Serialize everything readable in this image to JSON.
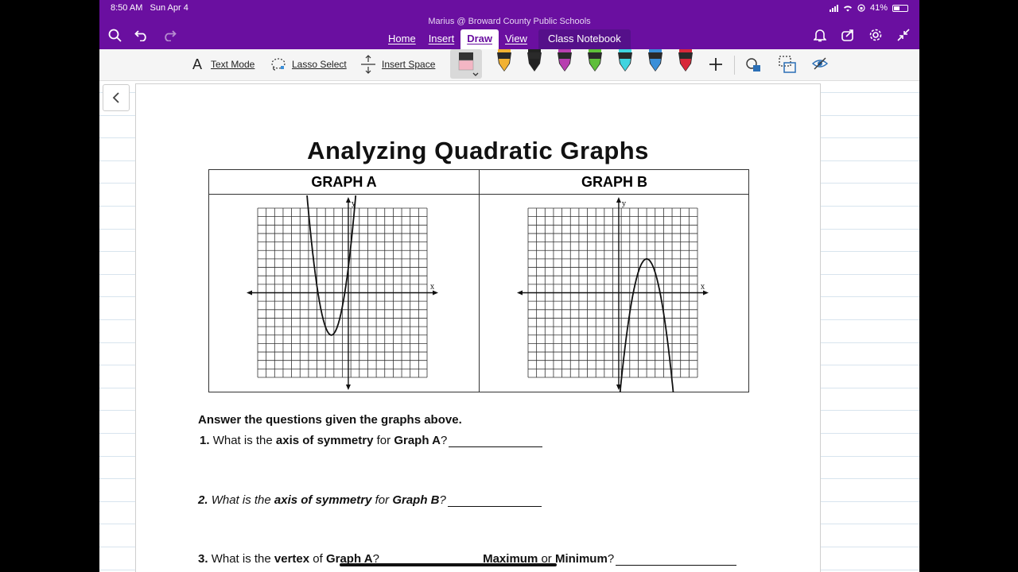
{
  "status": {
    "time": "8:50 AM",
    "date": "Sun Apr 4",
    "battery": "41%"
  },
  "app": {
    "title": "Marius @ Broward County Public Schools"
  },
  "tabs": [
    {
      "label": "Home"
    },
    {
      "label": "Insert"
    },
    {
      "label": "Draw"
    },
    {
      "label": "View"
    },
    {
      "label": "Class Notebook"
    }
  ],
  "ribbon": {
    "text_mode": "Text Mode",
    "lasso_select": "Lasso Select",
    "insert_space": "Insert Space"
  },
  "pens": [
    {
      "color": "#f2b233"
    },
    {
      "color": "#222222"
    },
    {
      "color": "#b83fb0"
    },
    {
      "color": "#5fbf3a"
    },
    {
      "color": "#3fd4e0"
    },
    {
      "color": "#3a8fd9"
    },
    {
      "color": "#d8283a"
    }
  ],
  "worksheet": {
    "title": "Analyzing Quadratic Graphs",
    "graph_a_label": "GRAPH A",
    "graph_b_label": "GRAPH B",
    "axis_x": "x",
    "axis_y": "y",
    "instructions": "Answer the questions given the graphs above.",
    "q1": {
      "num": "1.",
      "p1": "What is the ",
      "b1": "axis of symmetry",
      "p2": " for ",
      "b2": "Graph A",
      "p3": "?"
    },
    "q2": {
      "num": "2.",
      "p1": "What is the ",
      "b1": "axis of symmetry",
      "p2": " for ",
      "b2": "Graph B",
      "p3": "?"
    },
    "q3": {
      "num": "3.",
      "p1": "What is the ",
      "b1": "vertex",
      "p2": " of ",
      "b2": "Graph A",
      "p3": "?",
      "b3": "Maximum",
      "p4": " or ",
      "b4": "Minimum",
      "p5": "?"
    }
  }
}
